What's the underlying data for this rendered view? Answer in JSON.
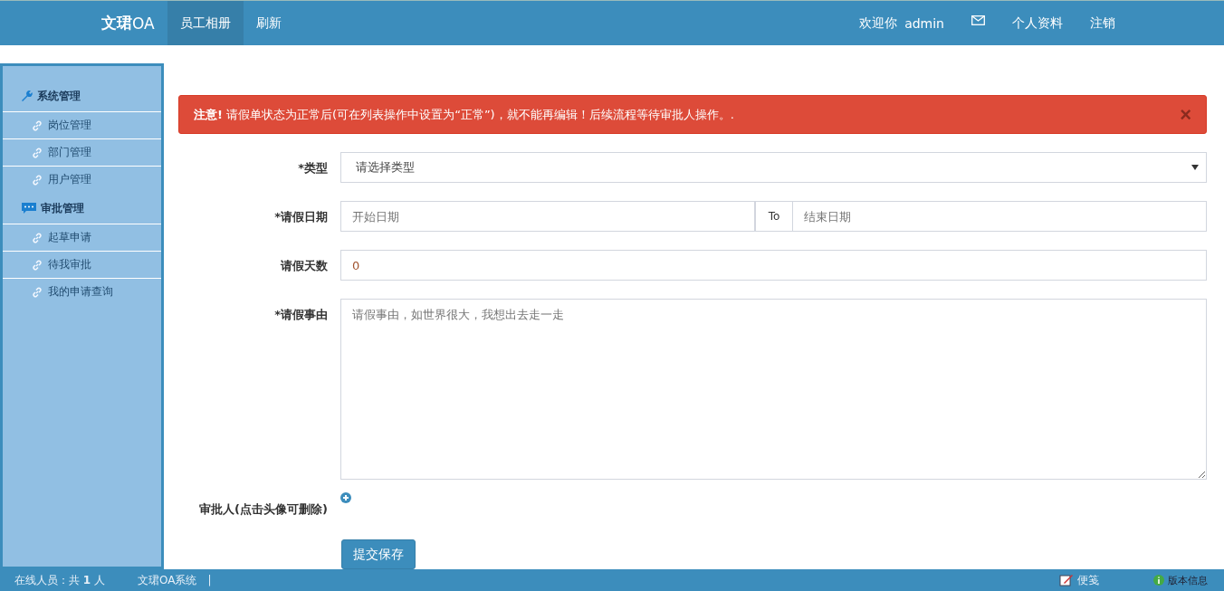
{
  "navbar": {
    "brand": "**文珺**OA",
    "tabs": [
      {
        "label": "员工相册",
        "selected": true
      },
      {
        "label": "刷新",
        "selected": false
      }
    ],
    "welcome": "欢迎你",
    "user": "admin",
    "links": [
      "个人资料",
      "注销"
    ]
  },
  "sidebar": {
    "groups": [
      {
        "title": "系统管理",
        "kind": "wrench",
        "children": [
          {
            "label": "岗位管理"
          },
          {
            "label": "部门管理"
          },
          {
            "label": "用户管理"
          }
        ]
      },
      {
        "title": "审批管理",
        "kind": "chat",
        "children": [
          {
            "label": "起草申请"
          },
          {
            "label": "待我审批"
          },
          {
            "label": "我的申请查询"
          }
        ]
      }
    ]
  },
  "alert": {
    "text": "**注意!** 请假单状态为正常后(可在列表操作中设置为“正常”)，就不能再编辑！后续流程等待审批人操作。.",
    "close": "×"
  },
  "form": {
    "fields": [
      {
        "kind": "select",
        "label": "*类型",
        "value": "请选择类型"
      },
      {
        "kind": "daterange",
        "label": "*请假日期",
        "start_placeholder": "开始日期",
        "separator": "To",
        "end_placeholder": "结束日期"
      },
      {
        "kind": "text",
        "label": "请假天数",
        "value": "0"
      },
      {
        "kind": "textarea",
        "label": "*请假事由",
        "placeholder": "请假事由，如世界很大，我想出去走一走"
      },
      {
        "kind": "approver",
        "label": "审批人(点击头像可删除)"
      }
    ],
    "submit": "提交保存"
  },
  "status_bar": {
    "online": "在线人员：共 **1** 人",
    "system": "文珺OA系统",
    "separator": "|",
    "note": "便笺",
    "version": "版本信息"
  }
}
